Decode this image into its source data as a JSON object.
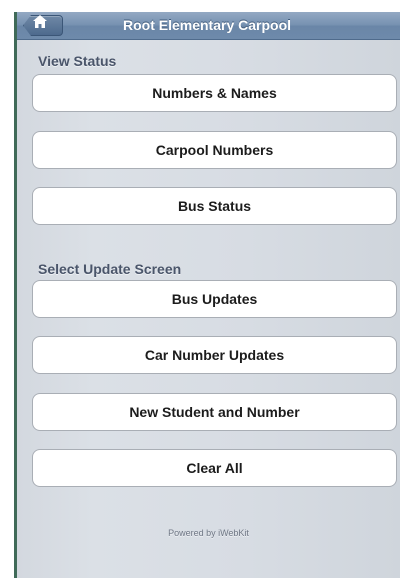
{
  "header": {
    "title": "Root Elementary Carpool",
    "home_icon": "home-icon"
  },
  "sections": [
    {
      "label": "View Status",
      "buttons": [
        "Numbers & Names",
        "Carpool Numbers",
        "Bus Status"
      ]
    },
    {
      "label": "Select Update Screen",
      "buttons": [
        "Bus Updates",
        "Car Number Updates",
        "New Student and Number",
        "Clear All"
      ]
    }
  ],
  "footer": {
    "text": "Powered by iWebKit"
  },
  "colors": {
    "toolbar": "#7590b0",
    "section_label": "#4a556a",
    "background": "#d7dce3"
  }
}
